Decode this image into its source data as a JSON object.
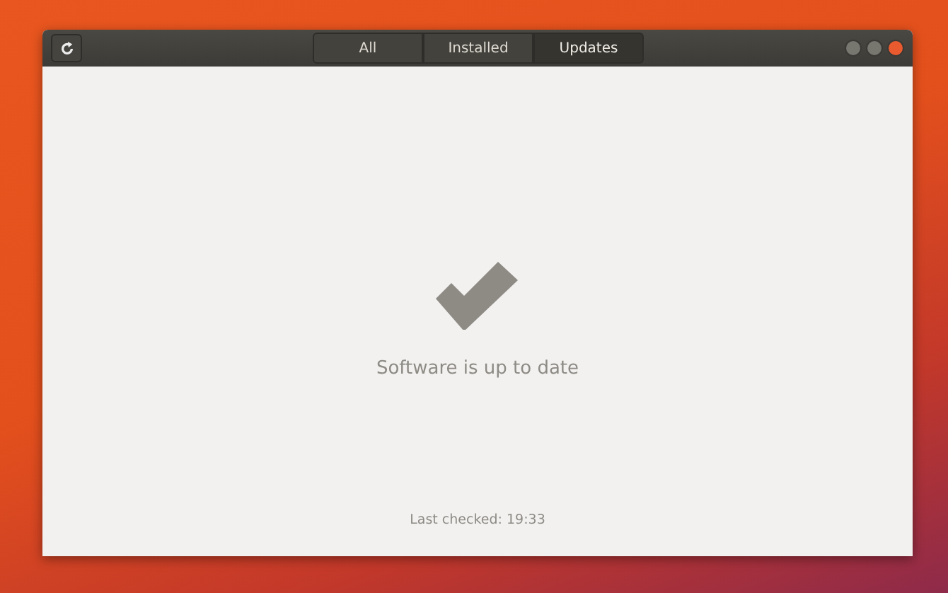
{
  "tabs": [
    {
      "label": "All",
      "selected": false
    },
    {
      "label": "Installed",
      "selected": false
    },
    {
      "label": "Updates",
      "selected": true
    }
  ],
  "status": {
    "message": "Software is up to date",
    "last_checked": "Last checked: 19:33"
  }
}
